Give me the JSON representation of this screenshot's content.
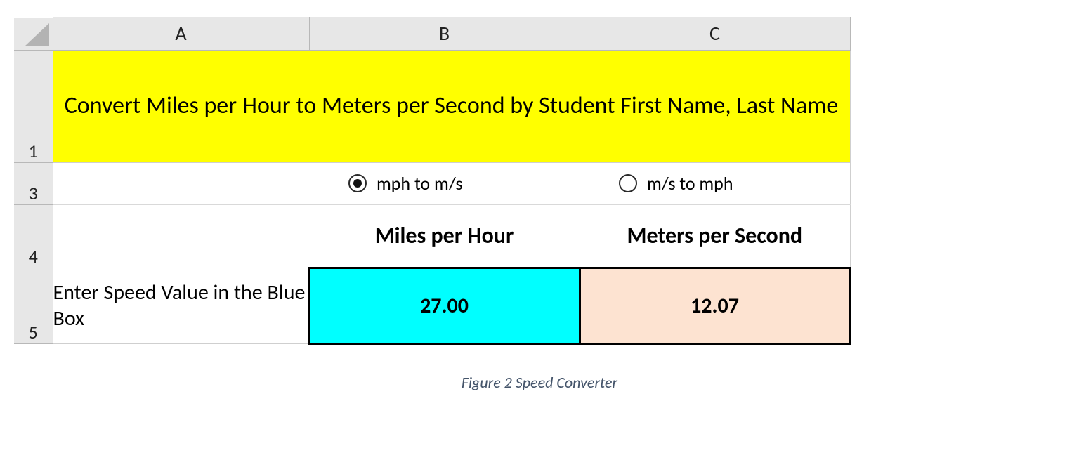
{
  "columns": {
    "A": "A",
    "B": "B",
    "C": "C"
  },
  "row_numbers": {
    "r1": "1",
    "r3": "3",
    "r4": "4",
    "r5": "5"
  },
  "title": "Convert Miles per Hour to Meters per Second by Student First Name, Last Name",
  "radios": {
    "mph_to_ms": {
      "label": "mph to m/s",
      "selected": true
    },
    "ms_to_mph": {
      "label": "m/s to mph",
      "selected": false
    }
  },
  "unit_headers": {
    "left": "Miles per Hour",
    "right": "Meters per Second"
  },
  "row5": {
    "label": "Enter Speed Value in the Blue Box",
    "input_value": "27.00",
    "output_value": "12.07"
  },
  "caption": "Figure 2 Speed Converter",
  "colors": {
    "title_bg": "#ffff00",
    "input_bg": "#00ffff",
    "output_bg": "#fde3d1"
  }
}
